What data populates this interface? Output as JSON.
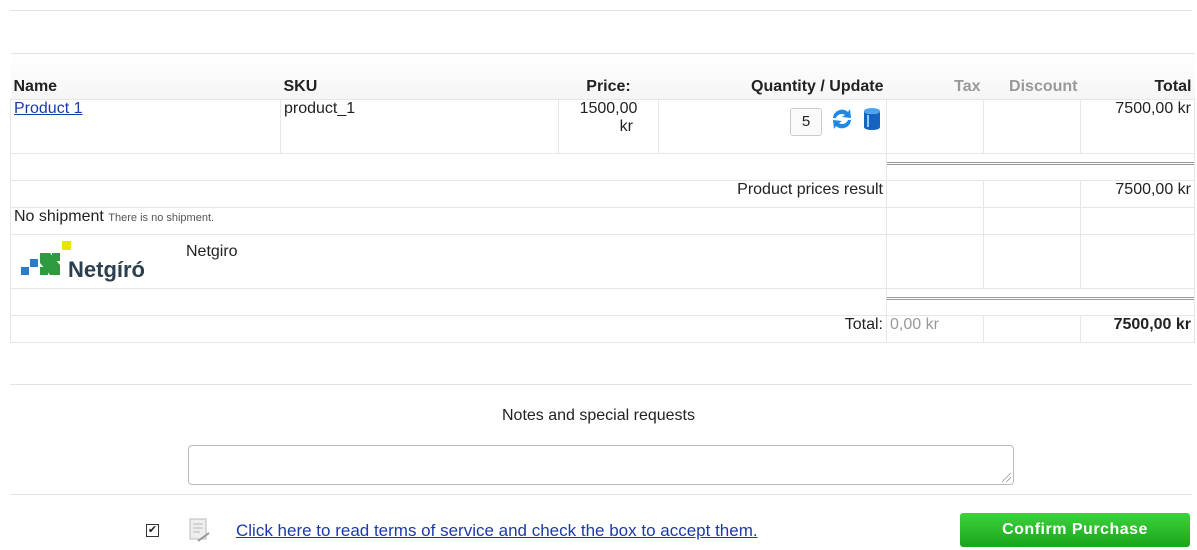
{
  "table": {
    "headers": {
      "name": "Name",
      "sku": "SKU",
      "price": "Price:",
      "qty": "Quantity / Update",
      "tax": "Tax",
      "discount": "Discount",
      "total": "Total"
    },
    "product": {
      "name": "Product 1",
      "sku": "product_1",
      "price_line1": "1500,00",
      "price_line2": "kr",
      "quantity": "5",
      "total": "7500,00 kr"
    },
    "product_prices_label": "Product prices result",
    "product_prices_total": "7500,00 kr",
    "shipment_label": "No shipment",
    "shipment_note": "There is no shipment.",
    "payment_name": "Netgiro",
    "payment_logo_text": "Netgíró",
    "total_label": "Total:",
    "total_tax": "0,00 kr",
    "grand_total": "7500,00 kr"
  },
  "notes_label": "Notes and special requests",
  "tos": {
    "checked": true,
    "link_text": "Click here to read terms of service and check the box to accept them."
  },
  "confirm_label": "Confirm Purchase",
  "colors": {
    "link": "#1a3aa8",
    "confirm_button": "#22b022",
    "icon_blue": "#1e88e5",
    "logo_green": "#2e9b3e",
    "logo_yellow": "#e6e600",
    "logo_blue": "#2b7bc9"
  }
}
